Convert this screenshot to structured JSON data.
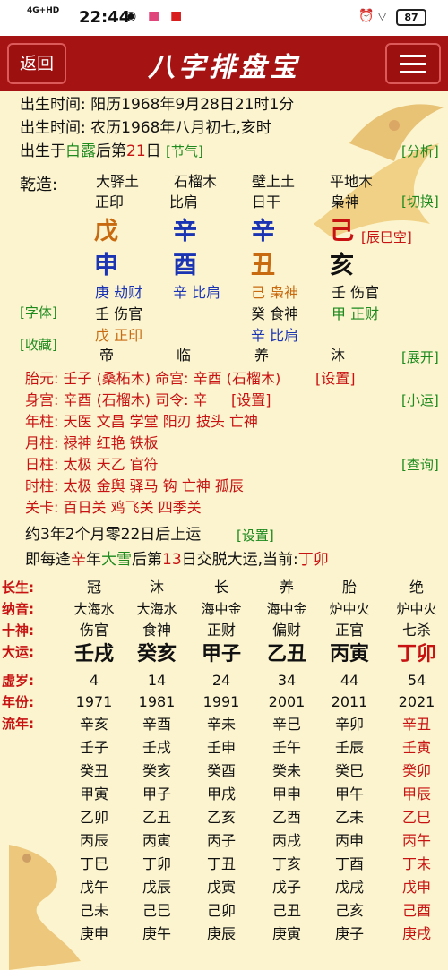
{
  "status": {
    "network": "4G+HD",
    "time": "22:44",
    "battery": "87"
  },
  "header": {
    "back": "返回",
    "title": "八字排盘宝"
  },
  "info": {
    "line1": "出生时间: 阳历1968年9月28日21时1分",
    "line2": "出生时间: 农历1968年八月初七,亥时",
    "line3a": "出生于",
    "line3b": "白露",
    "line3c": "后第",
    "line3d": "21",
    "line3e": "日",
    "line3f": "[节气]",
    "analyze": "[分析]"
  },
  "chart": {
    "label": "乾造:",
    "switch": "[切换]",
    "nayin": [
      "大驿土",
      "石榴木",
      "壁上土",
      "平地木"
    ],
    "shishen": [
      "正印",
      "比肩",
      "日干",
      "枭神"
    ],
    "stems": [
      "戊",
      "辛",
      "辛",
      "己"
    ],
    "kongwang": "[辰巳空]",
    "branches": [
      "申",
      "酉",
      "丑",
      "亥"
    ],
    "font": "[字体]",
    "collect": "[收藏]",
    "expand": "[展开]",
    "hidden": [
      [
        "庚 劫财",
        "辛 比肩",
        "己 枭神",
        "壬 伤官"
      ],
      [
        "壬 伤官",
        "",
        "癸 食神",
        "甲 正财"
      ],
      [
        "戊 正印",
        "",
        "辛 比肩",
        ""
      ]
    ],
    "changsheng": [
      "帝",
      "临",
      "养",
      "沐"
    ]
  },
  "extra": {
    "taiyuan": "胎元: 壬子 (桑柘木) 命宫: 辛酉 (石榴木)",
    "set1": "[设置]",
    "shengong": "身宫: 辛酉 (石榴木) 司令: 辛",
    "set2": "[设置]",
    "xiaoyun": "[小运]",
    "nianzhu": "年柱: 天医 文昌 学堂 阳刃 披头 亡神",
    "yuezhu": "月柱: 禄神 红艳 铁板",
    "rizhu": "日柱: 太极 天乙 官符",
    "query": "[查询]",
    "shizhu": "时柱: 太极 金舆 驿马 钩 亡神 孤辰",
    "guanka": "关卡: 百日关 鸡飞关 四季关"
  },
  "dayun": {
    "start": "约3年2个月零22日后上运",
    "set": "[设置]",
    "jiaoyun_a": "即每逢",
    "jiaoyun_b": "辛",
    "jiaoyun_c": "年",
    "jiaoyun_d": "大雪",
    "jiaoyun_e": "后第",
    "jiaoyun_f": "13",
    "jiaoyun_g": "日交脱大运,当前:",
    "jiaoyun_h": "丁卯",
    "rowlabels": [
      "长生:",
      "纳音:",
      "十神:",
      "大运:",
      "虚岁:",
      "年份:",
      "流年:"
    ],
    "changsheng": [
      "冠",
      "沐",
      "长",
      "养",
      "胎",
      "绝"
    ],
    "nayin": [
      "大海水",
      "大海水",
      "海中金",
      "海中金",
      "炉中火",
      "炉中火"
    ],
    "shishen": [
      "伤官",
      "食神",
      "正财",
      "偏财",
      "正官",
      "七杀"
    ],
    "ganzhi": [
      "壬戌",
      "癸亥",
      "甲子",
      "乙丑",
      "丙寅",
      "丁卯"
    ],
    "age": [
      "4",
      "14",
      "24",
      "34",
      "44",
      "54"
    ],
    "year": [
      "1971",
      "1981",
      "1991",
      "2001",
      "2011",
      "2021"
    ],
    "liunian": [
      [
        "辛亥",
        "辛酉",
        "辛未",
        "辛巳",
        "辛卯",
        "辛丑"
      ],
      [
        "壬子",
        "壬戌",
        "壬申",
        "壬午",
        "壬辰",
        "壬寅"
      ],
      [
        "癸丑",
        "癸亥",
        "癸酉",
        "癸未",
        "癸巳",
        "癸卯"
      ],
      [
        "甲寅",
        "甲子",
        "甲戌",
        "甲申",
        "甲午",
        "甲辰"
      ],
      [
        "乙卯",
        "乙丑",
        "乙亥",
        "乙酉",
        "乙未",
        "乙巳"
      ],
      [
        "丙辰",
        "丙寅",
        "丙子",
        "丙戌",
        "丙申",
        "丙午"
      ],
      [
        "丁巳",
        "丁卯",
        "丁丑",
        "丁亥",
        "丁酉",
        "丁未"
      ],
      [
        "戊午",
        "戊辰",
        "戊寅",
        "戊子",
        "戊戌",
        "戊申"
      ],
      [
        "己未",
        "己巳",
        "己卯",
        "己丑",
        "己亥",
        "己酉"
      ],
      [
        "庚申",
        "庚午",
        "庚辰",
        "庚寅",
        "庚子",
        "庚戌"
      ]
    ]
  }
}
